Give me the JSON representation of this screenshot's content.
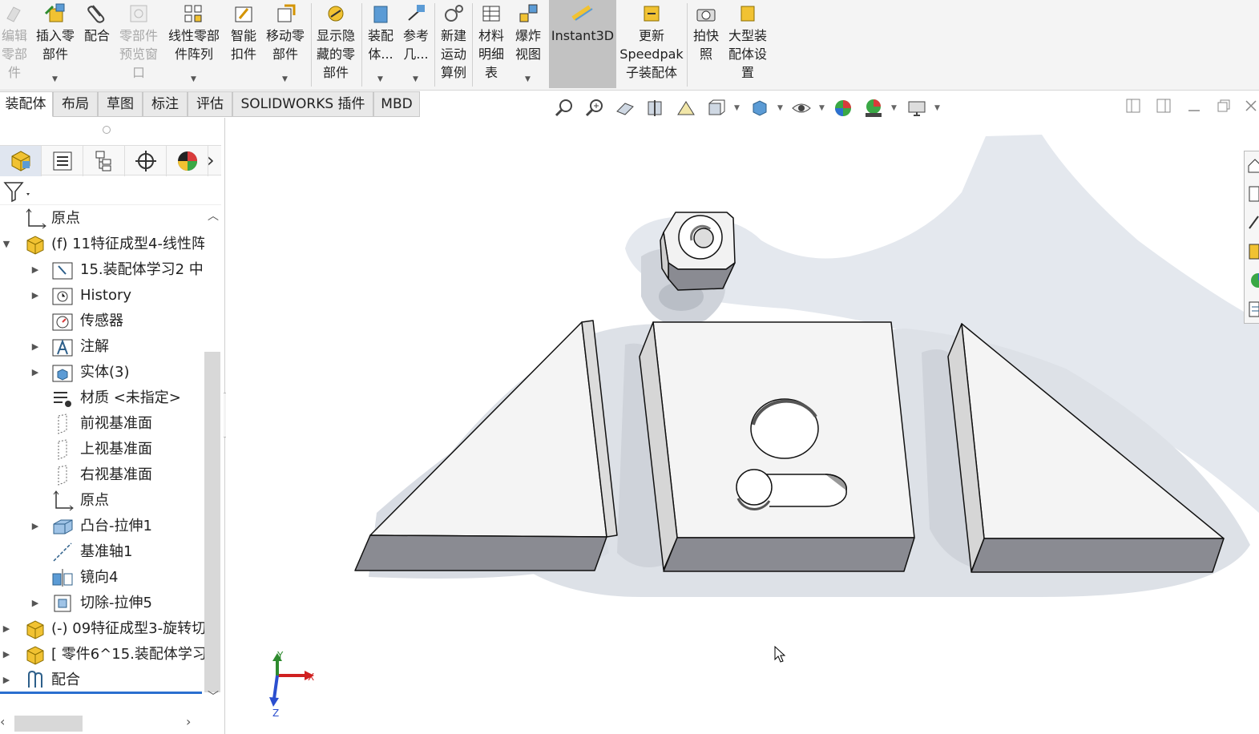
{
  "ribbon": {
    "buttons": [
      {
        "label": "编辑\n零部\n件",
        "disabled": true
      },
      {
        "label": "插入零\n部件"
      },
      {
        "label": "配合"
      },
      {
        "label": "零部件\n预览窗\n口",
        "disabled": true
      },
      {
        "label": "线性零部\n件阵列"
      },
      {
        "label": "智能\n扣件"
      },
      {
        "label": "移动零\n部件"
      },
      {
        "label": "显示隐\n藏的零\n部件"
      },
      {
        "label": "装配\n体..."
      },
      {
        "label": "参考\n几..."
      },
      {
        "label": "新建\n运动\n算例"
      },
      {
        "label": "材料\n明细\n表"
      },
      {
        "label": "爆炸\n视图"
      },
      {
        "label": "Instant3D",
        "active": true
      },
      {
        "label": "更新\nSpeedpak\n子装配体"
      },
      {
        "label": "拍快\n照"
      },
      {
        "label": "大型装\n配体设\n置"
      }
    ]
  },
  "tabs": [
    "装配体",
    "布局",
    "草图",
    "标注",
    "评估",
    "SOLIDWORKS 插件",
    "MBD"
  ],
  "tree": {
    "items": [
      {
        "label": "原点"
      },
      {
        "label": "(f) 11特征成型4-线性阵"
      },
      {
        "label": "15.装配体学习2 中|"
      },
      {
        "label": "History"
      },
      {
        "label": "传感器"
      },
      {
        "label": "注解"
      },
      {
        "label": "实体(3)"
      },
      {
        "label": "材质 <未指定>"
      },
      {
        "label": "前视基准面"
      },
      {
        "label": "上视基准面"
      },
      {
        "label": "右视基准面"
      },
      {
        "label": "原点"
      },
      {
        "label": "凸台-拉伸1"
      },
      {
        "label": "基准轴1"
      },
      {
        "label": "镜向4"
      },
      {
        "label": "切除-拉伸5"
      },
      {
        "label": "(-) 09特征成型3-旋转切"
      },
      {
        "label": "[ 零件6^15.装配体学习"
      },
      {
        "label": "配合"
      }
    ]
  },
  "triad": {
    "x": "X",
    "y": "Y",
    "z": "Z"
  },
  "colors": {
    "accent": "#2a6fcf",
    "active_tool": "#c2c2c2"
  }
}
